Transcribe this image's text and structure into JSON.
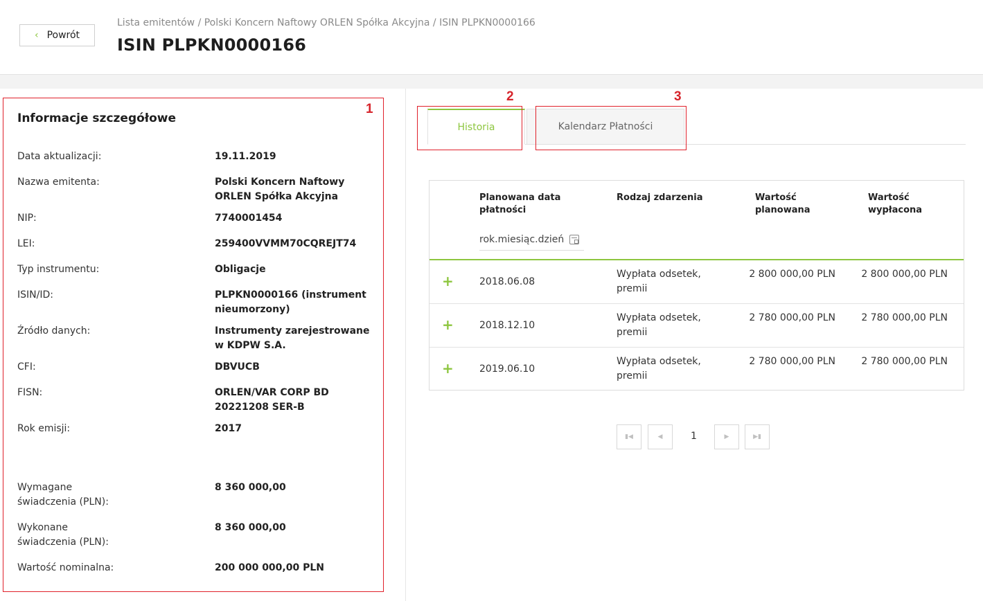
{
  "header": {
    "back_label": "Powrót",
    "breadcrumb": "Lista emitentów / Polski Koncern Naftowy ORLEN Spółka Akcyjna / ISIN PLPKN0000166",
    "title": "ISIN PLPKN0000166"
  },
  "annotations": {
    "n1": "1",
    "n2": "2",
    "n3": "3",
    "color": "#e0202a"
  },
  "details": {
    "title": "Informacje szczegółowe",
    "rows": [
      {
        "label": "Data aktualizacji:",
        "value": "19.11.2019"
      },
      {
        "label": "Nazwa emitenta:",
        "value": "Polski Koncern Naftowy ORLEN Spółka Akcyjna"
      },
      {
        "label": "NIP:",
        "value": "7740001454"
      },
      {
        "label": "LEI:",
        "value": "259400VVMM70CQREJT74"
      },
      {
        "label": "Typ instrumentu:",
        "value": "Obligacje"
      },
      {
        "label": "ISIN/ID:",
        "value": "PLPKN0000166 (instrument nieumorzony)"
      },
      {
        "label": "Źródło danych:",
        "value": "Instrumenty zarejestrowane w KDPW S.A."
      },
      {
        "label": "CFI:",
        "value": "DBVUCB"
      },
      {
        "label": "FISN:",
        "value": "ORLEN/VAR CORP BD 20221208 SER-B"
      },
      {
        "label": "Rok emisji:",
        "value": "2017"
      },
      {
        "label": "Wymagane świadczenia (PLN):",
        "value": "8 360 000,00"
      },
      {
        "label": "Wykonane świadczenia (PLN):",
        "value": "8 360 000,00"
      },
      {
        "label": "Wartość nominalna:",
        "value": "200 000 000,00 PLN"
      }
    ]
  },
  "tabs": {
    "history": "Historia",
    "calendar": "Kalendarz Płatności"
  },
  "table": {
    "headers": {
      "date": "Planowana data płatności",
      "type": "Rodzaj zdarzenia",
      "planned": "Wartość planowana",
      "paid": "Wartość wypłacona"
    },
    "date_placeholder": "rok.miesiąc.dzień",
    "expand_symbol": "+",
    "rows": [
      {
        "date": "2018.06.08",
        "type": "Wypłata odsetek, premii",
        "planned": "2 800 000,00 PLN",
        "paid": "2 800 000,00 PLN"
      },
      {
        "date": "2018.12.10",
        "type": "Wypłata odsetek, premii",
        "planned": "2 780 000,00 PLN",
        "paid": "2 780 000,00 PLN"
      },
      {
        "date": "2019.06.10",
        "type": "Wypłata odsetek, premii",
        "planned": "2 780 000,00 PLN",
        "paid": "2 780 000,00 PLN"
      }
    ]
  },
  "pagination": {
    "current_page": "1"
  },
  "colors": {
    "accent": "#8dc63f",
    "annotation": "#e0202a"
  }
}
